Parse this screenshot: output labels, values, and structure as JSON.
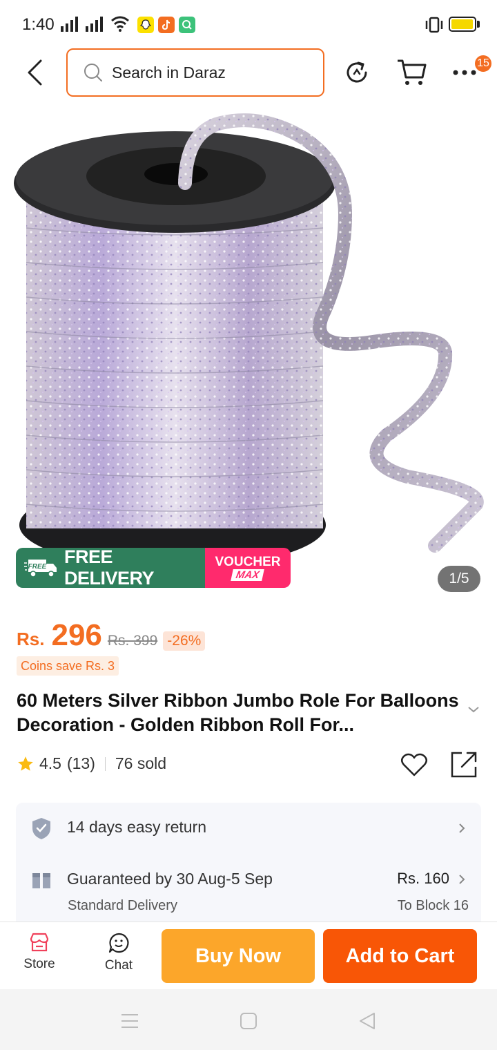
{
  "status_bar": {
    "time": "1:40",
    "icons": [
      "signal-icon",
      "signal-icon",
      "wifi-icon",
      "snapchat-icon",
      "tiktok-icon",
      "app-icon",
      "vibrate-icon",
      "battery-icon"
    ]
  },
  "header": {
    "search_placeholder": "Search in Daraz",
    "cart_badge": "15"
  },
  "gallery": {
    "indicator": "1/5",
    "promo_free_tag": "FREE",
    "promo_free": "FREE DELIVERY",
    "promo_voucher_top": "VOUCHER",
    "promo_voucher_bottom": "MAX"
  },
  "product": {
    "currency": "Rs.",
    "price": "296",
    "old_price": "Rs. 399",
    "discount": "-26%",
    "coins": "Coins save Rs. 3",
    "title": "60 Meters Silver Ribbon Jumbo Role For Balloons Decoration - Golden Ribbon Roll For...",
    "rating": "4.5",
    "reviews": "(13)",
    "sold": "76 sold"
  },
  "info": {
    "return_text": "14 days easy return",
    "delivery_text": "Guaranteed by 30 Aug-5 Sep",
    "delivery_sub": "Standard Delivery",
    "delivery_price": "Rs. 160",
    "delivery_location": "To Block 16"
  },
  "actions": {
    "store": "Store",
    "chat": "Chat",
    "buy_now": "Buy Now",
    "add_to_cart": "Add to Cart"
  },
  "colors": {
    "accent": "#f36d21",
    "buy_now": "#fca62a",
    "add_to_cart": "#f85606",
    "free_delivery": "#2f7f5c",
    "voucher": "#ff2a6d"
  }
}
